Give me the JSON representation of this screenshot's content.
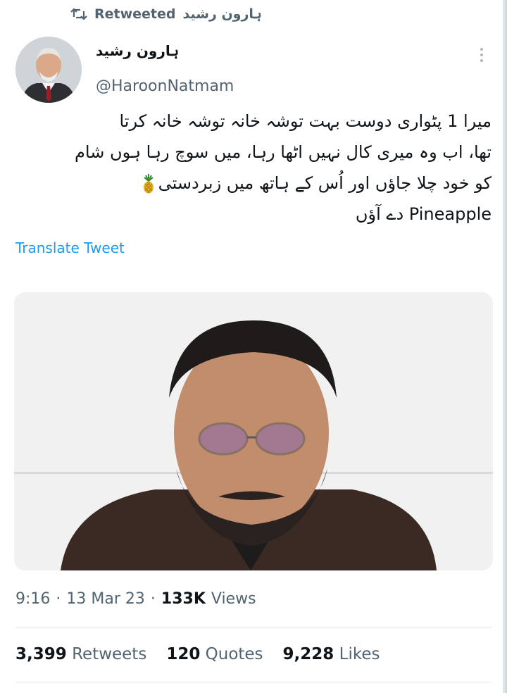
{
  "retweet": {
    "author": "ہارون رشید",
    "label": "Retweeted",
    "icon": "retweet-icon"
  },
  "tweet": {
    "display_name": "ہارون رشید",
    "handle": "@HaroonNatmam",
    "text_lines": [
      "میرا 1 پٹواری دوست بہت توشہ خانہ توشہ خانہ کرتا",
      "تھا، اب وہ میری کال نہیں اٹھا رہا، میں سوچ رہا ہوں شام",
      "کو خود چلا جاؤں اور اُس کے ہاتھ میں زبردستی",
      "Pineapple دے آؤں"
    ],
    "emoji": "pineapple-emoji",
    "translate_label": "Translate Tweet",
    "time": "9:16",
    "date": "13 Mar 23",
    "views_count": "133K",
    "views_label": "Views",
    "retweets_count": "3,399",
    "retweets_label": "Retweets",
    "quotes_count": "120",
    "quotes_label": "Quotes",
    "likes_count": "9,228",
    "likes_label": "Likes"
  },
  "colors": {
    "link": "#1d9bf0",
    "muted": "#536471",
    "text": "#0f1419"
  }
}
